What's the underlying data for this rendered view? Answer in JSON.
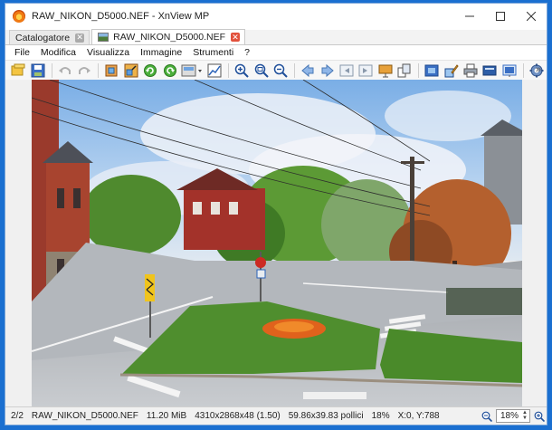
{
  "window": {
    "title": "RAW_NIKON_D5000.NEF - XnView MP",
    "controls": {
      "minimize": "—",
      "maximize": "☐",
      "close": "✕"
    }
  },
  "tabs": [
    {
      "label": "Catalogatore",
      "active": false
    },
    {
      "label": "RAW_NIKON_D5000.NEF",
      "active": true
    }
  ],
  "tab_close_glyph": "✕",
  "menu": [
    "File",
    "Modifica",
    "Visualizza",
    "Immagine",
    "Strumenti",
    "?"
  ],
  "toolbar": {
    "icons": [
      "browser-icon",
      "save-icon",
      "undo-icon",
      "redo-icon",
      "crop-icon",
      "resize-icon",
      "rotate-left-icon",
      "rotate-right-icon",
      "adjust-icon",
      "levels-icon",
      "zoom-in-icon",
      "zoom-fit-icon",
      "zoom-out-icon",
      "prev-icon",
      "next-icon",
      "first-icon",
      "last-icon",
      "slideshow-icon",
      "compare-icon",
      "fullscreen-icon",
      "edit-icon",
      "print-icon",
      "scanner-icon",
      "wallpaper-icon",
      "settings-icon"
    ],
    "overflow": "»"
  },
  "statusbar": {
    "page": "2/2",
    "filename": "RAW_NIKON_D5000.NEF",
    "filesize": "11.20 MiB",
    "dimensions": "4310x2868x48 (1.50)",
    "print_size": "59.86x39.83 pollici",
    "zoom_percent": "18%",
    "coordinates": "X:0, Y:788",
    "zoom_value": "18%"
  },
  "photo": {
    "description_colors": {
      "sky": "#9fc4ea",
      "grass": "#4f8e2e",
      "road": "#b9bcc0",
      "flowers": "#e0621c"
    }
  }
}
